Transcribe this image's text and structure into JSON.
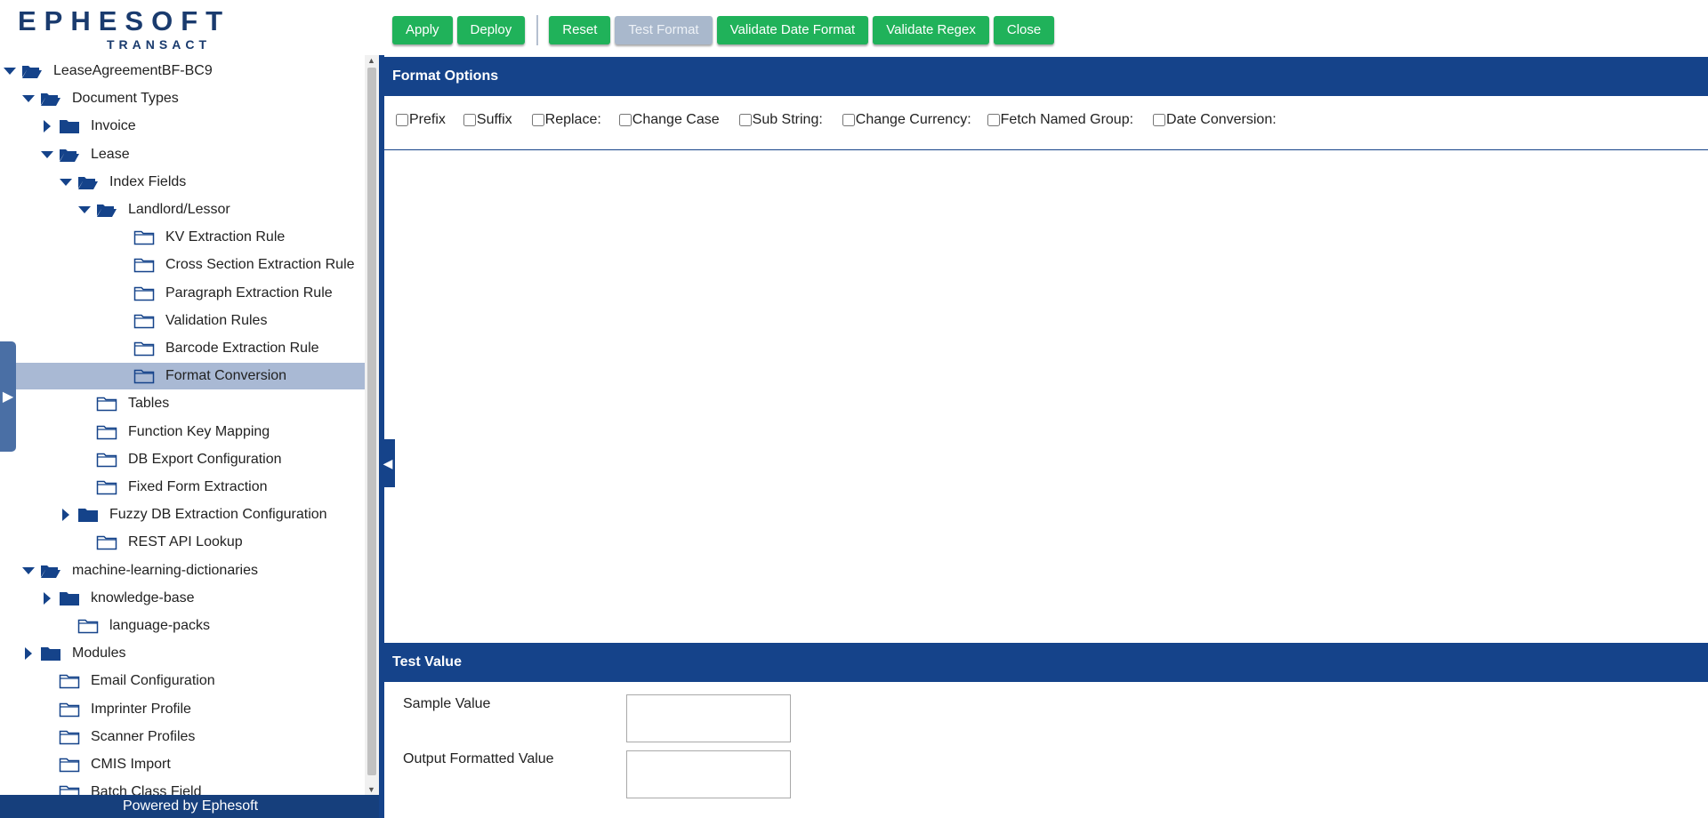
{
  "logo": {
    "brand": "EPHESOFT",
    "sub": "TRANSACT"
  },
  "toolbar": {
    "apply": "Apply",
    "deploy": "Deploy",
    "reset": "Reset",
    "test_format": "Test Format",
    "validate_date_format": "Validate Date Format",
    "validate_regex": "Validate Regex",
    "close": "Close"
  },
  "tree": {
    "nodes": [
      {
        "label": "LeaseAgreementBF-BC9",
        "caret": "down",
        "folder": "open"
      },
      {
        "label": "Document Types",
        "caret": "down",
        "folder": "open"
      },
      {
        "label": "Invoice",
        "caret": "right",
        "folder": "closed"
      },
      {
        "label": "Lease",
        "caret": "down",
        "folder": "open"
      },
      {
        "label": "Index Fields",
        "caret": "down",
        "folder": "open"
      },
      {
        "label": "Landlord/Lessor",
        "caret": "down",
        "folder": "open"
      },
      {
        "label": "KV Extraction Rule",
        "caret": "",
        "folder": "outline"
      },
      {
        "label": "Cross Section Extraction Rule",
        "caret": "",
        "folder": "outline"
      },
      {
        "label": "Paragraph Extraction Rule",
        "caret": "",
        "folder": "outline"
      },
      {
        "label": "Validation Rules",
        "caret": "",
        "folder": "outline"
      },
      {
        "label": "Barcode Extraction Rule",
        "caret": "",
        "folder": "outline"
      },
      {
        "label": "Format Conversion",
        "caret": "",
        "folder": "outline",
        "selected": true
      },
      {
        "label": "Tables",
        "caret": "",
        "folder": "outline"
      },
      {
        "label": "Function Key Mapping",
        "caret": "",
        "folder": "outline"
      },
      {
        "label": "DB Export Configuration",
        "caret": "",
        "folder": "outline"
      },
      {
        "label": "Fixed Form Extraction",
        "caret": "",
        "folder": "outline"
      },
      {
        "label": "Fuzzy DB Extraction Configuration",
        "caret": "right",
        "folder": "closed"
      },
      {
        "label": "REST API Lookup",
        "caret": "",
        "folder": "outline"
      },
      {
        "label": "machine-learning-dictionaries",
        "caret": "down",
        "folder": "open"
      },
      {
        "label": "knowledge-base",
        "caret": "right",
        "folder": "closed"
      },
      {
        "label": "language-packs",
        "caret": "",
        "folder": "outline"
      },
      {
        "label": "Modules",
        "caret": "right",
        "folder": "closed"
      },
      {
        "label": "Email Configuration",
        "caret": "",
        "folder": "outline"
      },
      {
        "label": "Imprinter Profile",
        "caret": "",
        "folder": "outline"
      },
      {
        "label": "Scanner Profiles",
        "caret": "",
        "folder": "outline"
      },
      {
        "label": "CMIS Import",
        "caret": "",
        "folder": "outline"
      },
      {
        "label": "Batch Class Field",
        "caret": "",
        "folder": "outline"
      }
    ]
  },
  "footer": {
    "text": "Powered by Ephesoft"
  },
  "format_options": {
    "title": "Format Options",
    "options": [
      {
        "label": "Prefix",
        "checked": false
      },
      {
        "label": "Suffix",
        "checked": false
      },
      {
        "label": "Replace:",
        "checked": false
      },
      {
        "label": "Change Case",
        "checked": false
      },
      {
        "label": "Sub String:",
        "checked": false
      },
      {
        "label": "Change Currency:",
        "checked": false
      },
      {
        "label": "Fetch Named Group:",
        "checked": false
      },
      {
        "label": "Date Conversion:",
        "checked": false
      }
    ]
  },
  "test_value": {
    "title": "Test Value",
    "sample_label": "Sample Value",
    "sample_value": "",
    "output_label": "Output Formatted Value",
    "output_value": ""
  },
  "colors": {
    "primary_blue": "#15438a",
    "button_green": "#20b25a",
    "disabled_button": "#a9b8cc",
    "selected_row": "#a9b9d4"
  }
}
